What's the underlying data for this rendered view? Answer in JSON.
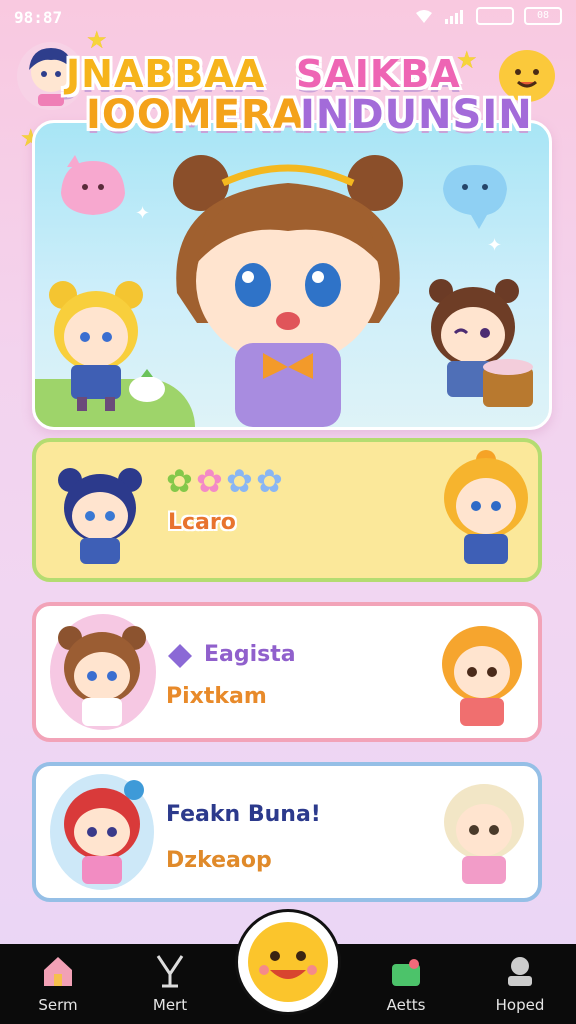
{
  "status_bar": {
    "time": "98:87",
    "battery_label": "08"
  },
  "title": {
    "line1_left": "JNABBAA",
    "line1_right": "SAIKBA",
    "line2_left": "IOOMERA",
    "line2_right": "INDUNSIN"
  },
  "cards": [
    {
      "label": "Lcaro",
      "color": "#e8732e"
    },
    {
      "title": "Eagista",
      "subtitle": "Pixtkam"
    },
    {
      "title": "Feakn Buna!",
      "subtitle": "Dzkeaop"
    }
  ],
  "nav": {
    "items": [
      {
        "label": "Serm",
        "icon": "home-icon"
      },
      {
        "label": "Mert",
        "icon": "trident-icon"
      },
      {
        "label": "Aetts",
        "icon": "bag-icon"
      },
      {
        "label": "Hoped",
        "icon": "profile-icon"
      }
    ],
    "fab_icon": "smiley-face-icon"
  },
  "colors": {
    "accent_pink": "#ee65b4",
    "accent_yellow": "#f6b41b",
    "card1_border": "#b4dc71",
    "card2_border": "#f2a3b8",
    "card3_border": "#95bfe6"
  }
}
